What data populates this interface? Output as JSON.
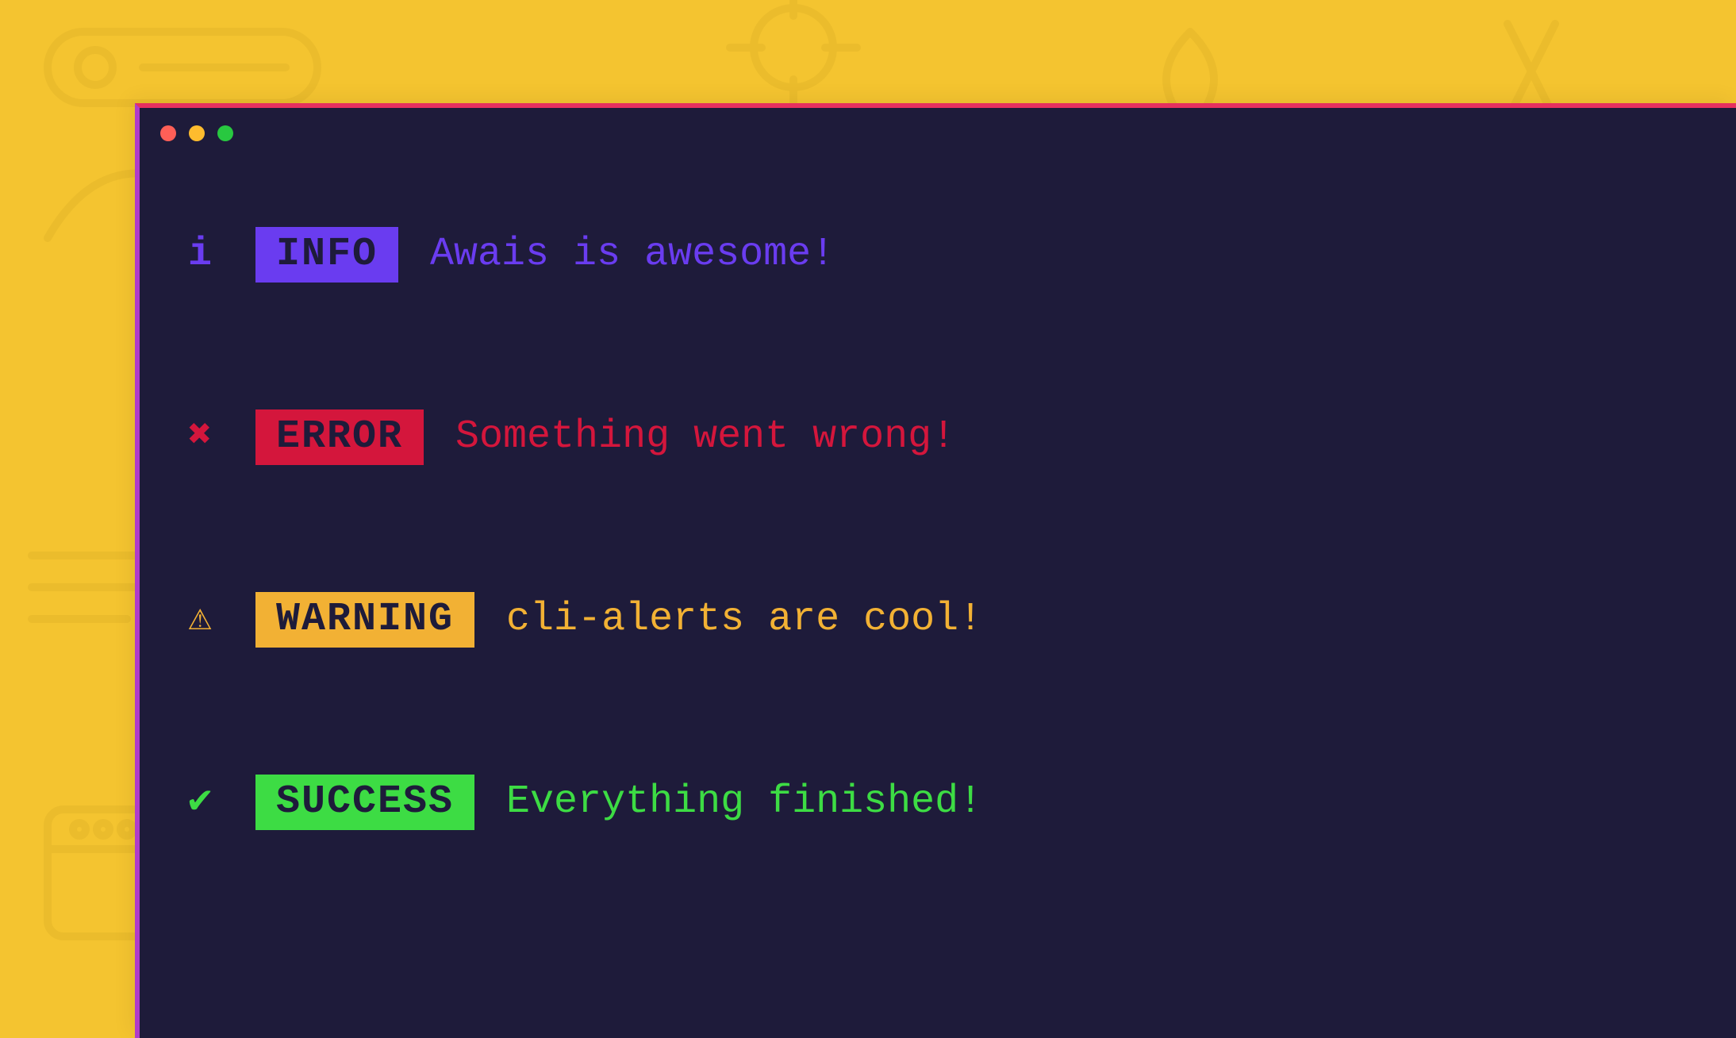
{
  "colors": {
    "page_bg": "#f4c430",
    "window_bg": "#1e1b3a",
    "window_border_top": "#e6305f",
    "window_border_left": "#b03cc9",
    "traffic_close": "#ff5f57",
    "traffic_min": "#febc2e",
    "traffic_zoom": "#28c840"
  },
  "alerts": [
    {
      "id": "info",
      "icon_glyph": "i",
      "label": " INFO ",
      "message": "Awais is awesome!",
      "badge_bg": "#6a3cf0",
      "badge_fg": "#1e1b3a",
      "text_color": "#6a3cf0",
      "icon_color": "#6a3cf0"
    },
    {
      "id": "error",
      "icon_glyph": "✖",
      "label": " ERROR ",
      "message": "Something went wrong!",
      "badge_bg": "#d4163c",
      "badge_fg": "#1e1b3a",
      "text_color": "#d4163c",
      "icon_color": "#d4163c"
    },
    {
      "id": "warning",
      "icon_glyph": "⚠",
      "label": " WARNING ",
      "message": "cli-alerts are cool!",
      "badge_bg": "#f2b134",
      "badge_fg": "#1e1b3a",
      "text_color": "#f2b134",
      "icon_color": "#f2b134"
    },
    {
      "id": "success",
      "icon_glyph": "✔",
      "label": " SUCCESS ",
      "message": "Everything finished!",
      "badge_bg": "#3ddc44",
      "badge_fg": "#1e1b3a",
      "text_color": "#3ddc44",
      "icon_color": "#3ddc44"
    }
  ]
}
